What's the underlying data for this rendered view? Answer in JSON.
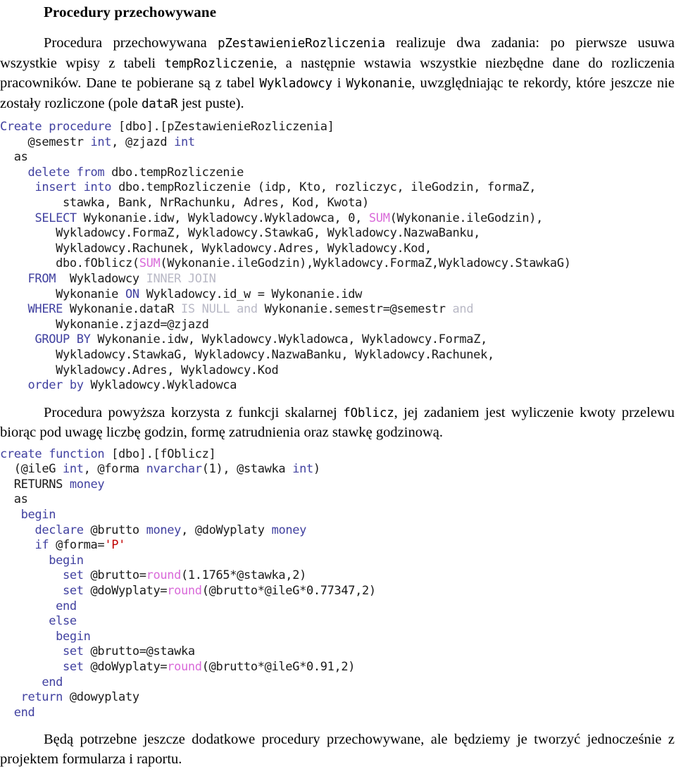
{
  "document": {
    "heading": "Procedury przechowywane",
    "paragraph_1": {
      "part_1": "Procedura przechowywana ",
      "code_1": "pZestawienieRozliczenia",
      "part_2": " realizuje dwa zadania: po pierwsze usuwa wszystkie wpisy z tabeli ",
      "code_2": "tempRozliczenie",
      "part_3": ", a następnie wstawia wszystkie niezbędne dane do rozliczenia pracowników. Dane te pobierane są z tabel ",
      "code_3": "Wykladowcy",
      "part_4": " i ",
      "code_4": "Wykonanie",
      "part_5": ", uwzględniając te rekordy, które jeszcze nie zostały rozliczone (pole ",
      "code_5": "dataR",
      "part_6": " jest puste)."
    },
    "paragraph_2": {
      "part_1": "Procedura powyższa korzysta z funkcji skalarnej ",
      "code_1": "fOblicz",
      "part_2": ", jej zadaniem jest wyliczenie kwoty przelewu biorąc pod uwagę liczbę godzin, formę zatrudnienia oraz stawkę godzinową."
    },
    "paragraph_3": {
      "part_1": "Będą potrzebne jeszcze dodatkowe procedury przechowywane, ale będziemy je tworzyć jednocześnie z projektem formularza i raportu."
    }
  },
  "code_block_procedure": {
    "language": "sql",
    "lines": [
      {
        "indent": 0,
        "tokens": [
          {
            "t": "Create procedure ",
            "c": "kw"
          },
          {
            "t": "[dbo].[pZestawienieRozliczenia]",
            "c": "id"
          }
        ]
      },
      {
        "indent": 4,
        "tokens": [
          {
            "t": "@semestr ",
            "c": "id"
          },
          {
            "t": "int",
            "c": "kw"
          },
          {
            "t": ", @zjazd ",
            "c": "id"
          },
          {
            "t": "int",
            "c": "kw"
          }
        ]
      },
      {
        "indent": 2,
        "tokens": [
          {
            "t": "as",
            "c": "id"
          }
        ]
      },
      {
        "indent": 4,
        "tokens": [
          {
            "t": "delete from ",
            "c": "kw"
          },
          {
            "t": "dbo.tempRozliczenie",
            "c": "id"
          }
        ]
      },
      {
        "indent": 5,
        "tokens": [
          {
            "t": "insert into ",
            "c": "kw"
          },
          {
            "t": "dbo.tempRozliczenie (idp, Kto, rozliczyc, ileGodzin, formaZ,",
            "c": "id"
          }
        ]
      },
      {
        "indent": 9,
        "tokens": [
          {
            "t": "stawka, Bank, NrRachunku, Adres, Kod, Kwota)",
            "c": "id"
          }
        ]
      },
      {
        "indent": 5,
        "tokens": [
          {
            "t": "SELECT ",
            "c": "kw"
          },
          {
            "t": "Wykonanie.idw, Wykladowcy.Wykladowca, 0, ",
            "c": "id"
          },
          {
            "t": "SUM",
            "c": "fn"
          },
          {
            "t": "(Wykonanie.ileGodzin),",
            "c": "id"
          }
        ]
      },
      {
        "indent": 8,
        "tokens": [
          {
            "t": "Wykladowcy.FormaZ, Wykladowcy.StawkaG, Wykladowcy.NazwaBanku,",
            "c": "id"
          }
        ]
      },
      {
        "indent": 8,
        "tokens": [
          {
            "t": "Wykladowcy.Rachunek, Wykladowcy.Adres, Wykladowcy.Kod,",
            "c": "id"
          }
        ]
      },
      {
        "indent": 8,
        "tokens": [
          {
            "t": "dbo.fOblicz(",
            "c": "id"
          },
          {
            "t": "SUM",
            "c": "fn"
          },
          {
            "t": "(Wykonanie.ileGodzin),Wykladowcy.FormaZ,Wykladowcy.StawkaG)",
            "c": "id"
          }
        ]
      },
      {
        "indent": 4,
        "tokens": [
          {
            "t": "FROM ",
            "c": "kw"
          },
          {
            "t": " Wykladowcy ",
            "c": "id"
          },
          {
            "t": "INNER JOIN",
            "c": "kw2"
          }
        ]
      },
      {
        "indent": 8,
        "tokens": [
          {
            "t": "Wykonanie ",
            "c": "id"
          },
          {
            "t": "ON",
            "c": "kw"
          },
          {
            "t": " Wykladowcy.id_w = Wykonanie.idw",
            "c": "id"
          }
        ]
      },
      {
        "indent": 4,
        "tokens": [
          {
            "t": "WHERE ",
            "c": "kw"
          },
          {
            "t": "Wykonanie.dataR ",
            "c": "id"
          },
          {
            "t": "IS NULL and",
            "c": "kw2"
          },
          {
            "t": " Wykonanie.semestr=@semestr ",
            "c": "id"
          },
          {
            "t": "and",
            "c": "kw2"
          }
        ]
      },
      {
        "indent": 8,
        "tokens": [
          {
            "t": "Wykonanie.zjazd=@zjazd",
            "c": "id"
          }
        ]
      },
      {
        "indent": 5,
        "tokens": [
          {
            "t": "GROUP BY ",
            "c": "kw"
          },
          {
            "t": "Wykonanie.idw, Wykladowcy.Wykladowca, Wykladowcy.FormaZ,",
            "c": "id"
          }
        ]
      },
      {
        "indent": 8,
        "tokens": [
          {
            "t": "Wykladowcy.StawkaG, Wykladowcy.NazwaBanku, Wykladowcy.Rachunek,",
            "c": "id"
          }
        ]
      },
      {
        "indent": 8,
        "tokens": [
          {
            "t": "Wykladowcy.Adres, Wykladowcy.Kod",
            "c": "id"
          }
        ]
      },
      {
        "indent": 4,
        "tokens": [
          {
            "t": "order by ",
            "c": "kw"
          },
          {
            "t": "Wykladowcy.Wykladowca",
            "c": "id"
          }
        ]
      }
    ]
  },
  "code_block_function": {
    "language": "sql",
    "lines": [
      {
        "indent": 0,
        "tokens": [
          {
            "t": "create function ",
            "c": "kw"
          },
          {
            "t": "[dbo].[fOblicz]",
            "c": "id"
          }
        ]
      },
      {
        "indent": 2,
        "tokens": [
          {
            "t": "(@ileG ",
            "c": "id"
          },
          {
            "t": "int",
            "c": "kw"
          },
          {
            "t": ", @forma ",
            "c": "id"
          },
          {
            "t": "nvarchar",
            "c": "kw"
          },
          {
            "t": "(1), @stawka ",
            "c": "id"
          },
          {
            "t": "int",
            "c": "kw"
          },
          {
            "t": ")",
            "c": "id"
          }
        ]
      },
      {
        "indent": 2,
        "tokens": [
          {
            "t": "RETURNS ",
            "c": "id"
          },
          {
            "t": "money",
            "c": "kw"
          }
        ]
      },
      {
        "indent": 2,
        "tokens": [
          {
            "t": "as",
            "c": "id"
          }
        ]
      },
      {
        "indent": 3,
        "tokens": [
          {
            "t": "begin",
            "c": "kw"
          }
        ]
      },
      {
        "indent": 5,
        "tokens": [
          {
            "t": "declare ",
            "c": "kw"
          },
          {
            "t": "@brutto ",
            "c": "id"
          },
          {
            "t": "money",
            "c": "kw"
          },
          {
            "t": ", @doWyplaty ",
            "c": "id"
          },
          {
            "t": "money",
            "c": "kw"
          }
        ]
      },
      {
        "indent": 5,
        "tokens": [
          {
            "t": "if",
            "c": "kw"
          },
          {
            "t": " @forma=",
            "c": "id"
          },
          {
            "t": "'P'",
            "c": "str"
          }
        ]
      },
      {
        "indent": 7,
        "tokens": [
          {
            "t": "begin",
            "c": "kw"
          }
        ]
      },
      {
        "indent": 9,
        "tokens": [
          {
            "t": "set",
            "c": "kw"
          },
          {
            "t": " @brutto=",
            "c": "id"
          },
          {
            "t": "round",
            "c": "fn"
          },
          {
            "t": "(1.1765*@stawka,2)",
            "c": "id"
          }
        ]
      },
      {
        "indent": 9,
        "tokens": [
          {
            "t": "set",
            "c": "kw"
          },
          {
            "t": " @doWyplaty=",
            "c": "id"
          },
          {
            "t": "round",
            "c": "fn"
          },
          {
            "t": "(@brutto*@ileG*0.77347,2)",
            "c": "id"
          }
        ]
      },
      {
        "indent": 8,
        "tokens": [
          {
            "t": "end",
            "c": "kw"
          }
        ]
      },
      {
        "indent": 7,
        "tokens": [
          {
            "t": "else",
            "c": "kw"
          }
        ]
      },
      {
        "indent": 8,
        "tokens": [
          {
            "t": "begin",
            "c": "kw"
          }
        ]
      },
      {
        "indent": 9,
        "tokens": [
          {
            "t": "set",
            "c": "kw"
          },
          {
            "t": " @brutto=@stawka",
            "c": "id"
          }
        ]
      },
      {
        "indent": 9,
        "tokens": [
          {
            "t": "set",
            "c": "kw"
          },
          {
            "t": " @doWyplaty=",
            "c": "id"
          },
          {
            "t": "round",
            "c": "fn"
          },
          {
            "t": "(@brutto*@ileG*0.91,2)",
            "c": "id"
          }
        ]
      },
      {
        "indent": 6,
        "tokens": [
          {
            "t": "end",
            "c": "kw"
          }
        ]
      },
      {
        "indent": 3,
        "tokens": [
          {
            "t": "return ",
            "c": "kw"
          },
          {
            "t": "@dowyplaty",
            "c": "id"
          }
        ]
      },
      {
        "indent": 2,
        "tokens": [
          {
            "t": "end",
            "c": "kw"
          }
        ]
      }
    ]
  },
  "colors": {
    "keyword": "#4141a0",
    "keyword_faded": "#b9b9c6",
    "function": "#d96ad9",
    "string": "#c00000",
    "identifier": "#1a1a1a",
    "text": "#000000",
    "background": "#ffffff"
  }
}
